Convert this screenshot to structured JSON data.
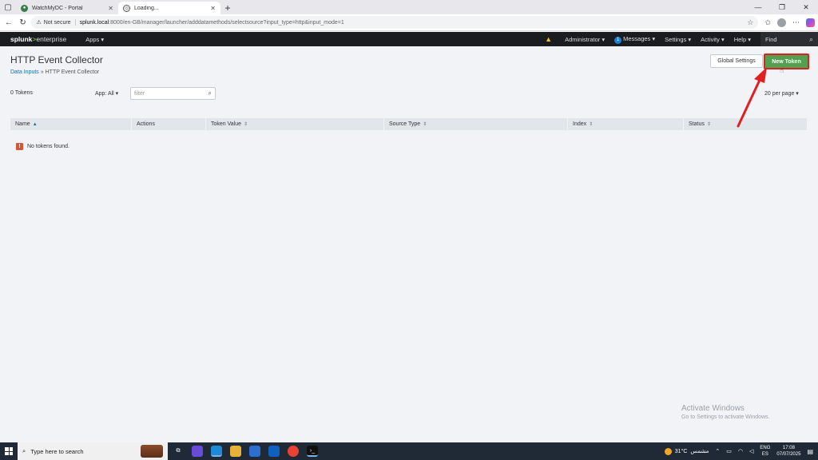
{
  "browser": {
    "tabs": [
      {
        "title": "WatchMyDC - Portal",
        "active": false
      },
      {
        "title": "Loading...",
        "active": true
      }
    ],
    "not_secure_label": "Not secure",
    "url_host": "splunk.local",
    "url_path": ":8000/en-GB/manager/launcher/adddatamethods/selectsource?input_type=http&input_mode=1"
  },
  "splunk_nav": {
    "logo_main": "splunk",
    "logo_gt": ">",
    "logo_ent": "enterprise",
    "apps_label": "Apps ▾",
    "administrator_label": "Administrator ▾",
    "messages_count": "1",
    "messages_label": "Messages ▾",
    "settings_label": "Settings ▾",
    "activity_label": "Activity ▾",
    "help_label": "Help ▾",
    "find_label": "Find"
  },
  "page": {
    "title": "HTTP Event Collector",
    "breadcrumb_link": "Data Inputs",
    "breadcrumb_sep": " » ",
    "breadcrumb_current": "HTTP Event Collector",
    "global_settings_label": "Global Settings",
    "new_token_label": "New Token",
    "token_count": "0 Tokens",
    "app_filter": "App: All ▾",
    "filter_placeholder": "filter",
    "per_page": "20 per page ▾",
    "no_tokens_text": "No tokens found."
  },
  "table": {
    "columns": [
      {
        "label": "Name",
        "sort": "▲",
        "width": 152
      },
      {
        "label": "Actions",
        "sort": "",
        "width": 93
      },
      {
        "label": "Token Value",
        "sort": "⇕",
        "width": 223
      },
      {
        "label": "Source Type",
        "sort": "⇕",
        "width": 230
      },
      {
        "label": "Index",
        "sort": "⇕",
        "width": 145
      },
      {
        "label": "Status",
        "sort": "⇕",
        "width": 155
      }
    ]
  },
  "watermark": {
    "line1": "Activate Windows",
    "line2": "Go to Settings to activate Windows."
  },
  "taskbar": {
    "search_placeholder": "Type here to search",
    "temperature": "31°C",
    "weather_text": "مشمس",
    "lang_top": "ENG",
    "lang_bottom": "ES",
    "time": "17:08",
    "date": "07/07/2025"
  },
  "colors": {
    "splunk_green": "#53a051",
    "highlight_red": "#e02020",
    "nav_bg": "#1a1c20"
  }
}
